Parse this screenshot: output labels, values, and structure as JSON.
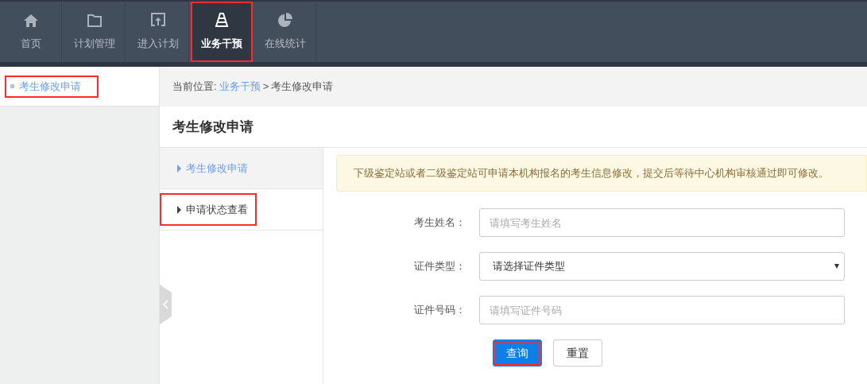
{
  "nav": [
    {
      "label": "首页",
      "selected": false,
      "highlighted": false
    },
    {
      "label": "计划管理",
      "selected": false,
      "highlighted": false
    },
    {
      "label": "进入计划",
      "selected": false,
      "highlighted": false
    },
    {
      "label": "业务干预",
      "selected": true,
      "highlighted": true
    },
    {
      "label": "在线统计",
      "selected": false,
      "highlighted": false
    }
  ],
  "sidebar": {
    "items": [
      {
        "label": "考生修改申请",
        "selected": true,
        "highlighted": true
      }
    ]
  },
  "breadcrumb": {
    "prefix": "当前位置:",
    "link": "业务干预",
    "separator": ">",
    "current": "考生修改申请"
  },
  "page_title": "考生修改申请",
  "submenu": [
    {
      "label": "考生修改申请",
      "selected": true,
      "highlighted": false
    },
    {
      "label": "申请状态查看",
      "selected": false,
      "highlighted": true
    }
  ],
  "notice": "下级鉴定站或者二级鉴定站可申请本机构报名的考生信息修改，提交后等待中心机构审核通过即可修改。",
  "form": [
    {
      "kind": "input",
      "label": "考生姓名：",
      "placeholder": "请填写考生姓名"
    },
    {
      "kind": "select",
      "label": "证件类型：",
      "value": "请选择证件类型"
    },
    {
      "kind": "input",
      "label": "证件号码：",
      "placeholder": "请填写证件号码"
    }
  ],
  "buttons": [
    {
      "label": "查询",
      "kind": "primary",
      "highlighted": true
    },
    {
      "label": "重置",
      "kind": "default",
      "highlighted": false
    }
  ]
}
